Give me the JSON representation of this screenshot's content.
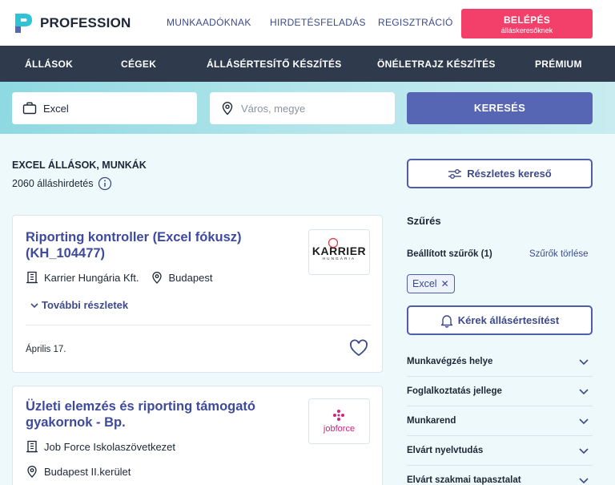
{
  "header": {
    "logo_text": "PROFESSION",
    "nav": [
      "MUNKAADÓKNAK",
      "HIRDETÉSFELADÁS",
      "REGISZTRÁCIÓ"
    ],
    "login_label": "BELÉPÉS",
    "login_sublabel": "álláskeresőknek"
  },
  "main_nav": [
    "ÁLLÁSOK",
    "CÉGEK",
    "ÁLLÁSÉRTESÍTŐ KÉSZÍTÉS",
    "ÖNÉLETRAJZ KÉSZÍTÉS",
    "PRÉMIUM"
  ],
  "search": {
    "keyword_value": "Excel",
    "location_placeholder": "Város, megye",
    "button_label": "KERESÉS"
  },
  "results": {
    "title": "EXCEL ÁLLÁSOK, MUNKÁK",
    "count_text": "2060 álláshirdetés",
    "detail_search_label": "Részletes kereső"
  },
  "jobs": [
    {
      "title": "Riporting kontroller (Excel fókusz) (KH_104477)",
      "company": "Karrier Hungária Kft.",
      "location": "Budapest",
      "logo_text": "KARRIER",
      "logo_subtext": "HUNGÁRIA",
      "more_label": "További részletek",
      "date": "Április 17."
    },
    {
      "title": "Üzleti elemzés és riporting támogató gyakornok - Bp.",
      "company": "Job Force Iskolaszövetkezet",
      "location": "Budapest II.kerület",
      "logo_text": "jobforce"
    }
  ],
  "filters": {
    "heading": "Szűrés",
    "applied_label": "Beállított szűrők (1)",
    "clear_label": "Szűrők törlése",
    "chip_label": "Excel",
    "alert_label": "Kérek állásértesítést",
    "sections": [
      "Munkavégzés helye",
      "Foglalkoztatás jellege",
      "Munkarend",
      "Elvárt nyelvtudás",
      "Elvárt szakmai tapasztalat"
    ]
  },
  "colors": {
    "accent": "#4f5ea8",
    "login": "#f2406a",
    "nav_bg": "#2f3b4d",
    "title": "#3d4a9e"
  }
}
